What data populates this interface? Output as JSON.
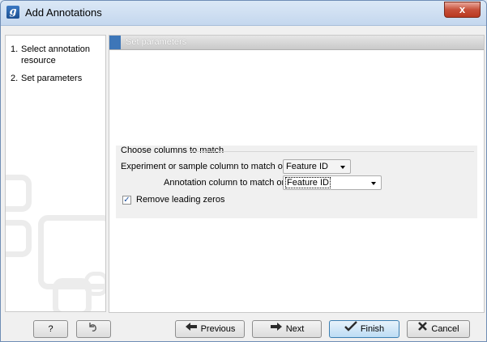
{
  "window": {
    "title": "Add Annotations",
    "app_icon_letter": "g",
    "close_glyph": "x"
  },
  "sidebar": {
    "steps": [
      {
        "number": "1.",
        "label": "Select annotation resource"
      },
      {
        "number": "2.",
        "label": "Set parameters"
      }
    ]
  },
  "panel": {
    "header": "Set parameters",
    "group_title": "Choose columns to match",
    "experiment_column_label": "Experiment or sample column to match on",
    "experiment_column_value": "Feature ID",
    "annotation_column_label": "Annotation column to match on",
    "annotation_column_value": "Feature ID",
    "remove_zeros_label": "Remove leading zeros",
    "remove_zeros_checked": true
  },
  "buttons": {
    "help": "?",
    "previous": "Previous",
    "next": "Next",
    "finish": "Finish",
    "cancel": "Cancel"
  },
  "colors": {
    "accent_blue": "#3d76b8",
    "finish_border": "#3c7fb1",
    "close_red": "#c7503a"
  }
}
